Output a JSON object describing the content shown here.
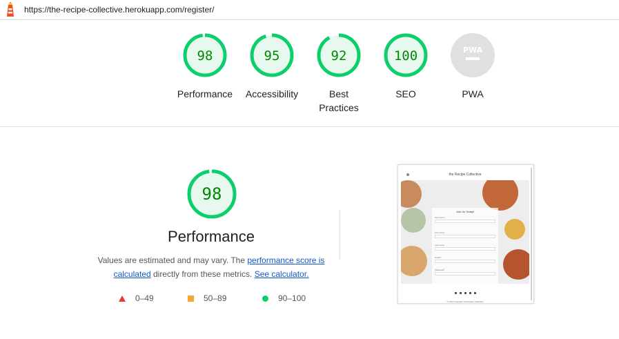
{
  "url": "https://the-recipe-collective.herokuapp.com/register/",
  "colors": {
    "pass": "#0cce6b",
    "pass_text": "#008800",
    "average": "#f4a63a",
    "fail": "#e53935",
    "na": "#e0e0e0"
  },
  "gauges": [
    {
      "score": "98",
      "label": "Performance"
    },
    {
      "score": "95",
      "label": "Accessibility"
    },
    {
      "score": "92",
      "label": "Best Practices",
      "label_line1": "Best",
      "label_line2": "Practices"
    },
    {
      "score": "100",
      "label": "SEO"
    },
    {
      "score": "PWA",
      "label": "PWA"
    }
  ],
  "gauge_values": [
    98,
    95,
    92,
    100
  ],
  "main": {
    "score": "98",
    "value": 98,
    "title": "Performance",
    "desc_prefix": "Values are estimated and may vary. The ",
    "link_score": "performance score is calculated",
    "desc_mid": " directly from these metrics. ",
    "link_calc": "See calculator."
  },
  "legend": {
    "fail": "0–49",
    "average": "50–89",
    "pass": "90–100"
  },
  "thumbnail": {
    "site_title": "the Recipe Collective",
    "form_title": "Join Us Today!",
    "fields": [
      "Username*",
      "First name",
      "Last name",
      "Email*",
      "Password*"
    ],
    "footer": "© 2021 Copyright: the Recipe Collective"
  },
  "icons": {
    "logo": "lighthouse-icon",
    "hamburger": "menu-icon"
  }
}
